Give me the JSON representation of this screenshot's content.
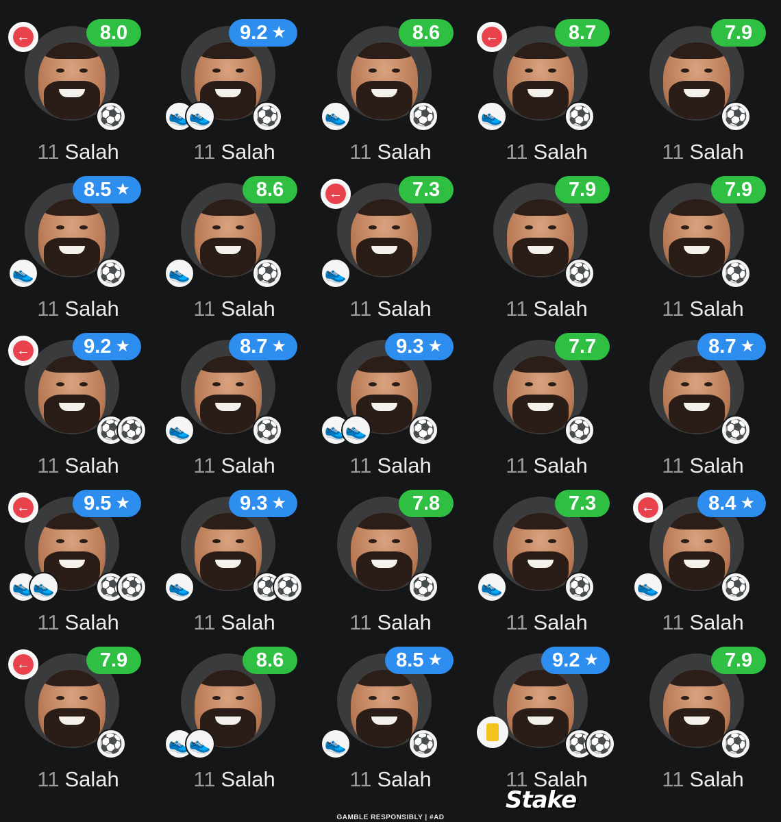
{
  "player_label": {
    "number": "11",
    "name": "Salah"
  },
  "icons": {
    "substitution": "substitution-arrow-icon",
    "goal": "football-icon",
    "assist": "boot-icon",
    "yellow_card": "yellow-card-icon",
    "motm": "star-icon"
  },
  "colors": {
    "rating_green": "#2fbf43",
    "rating_blue": "#2d8ef0",
    "sub_red": "#e8434c",
    "card_yellow": "#f2c31a"
  },
  "cards": [
    {
      "rating": "8.0",
      "star": false,
      "subbed": true,
      "yellow": false,
      "assists": 0,
      "goals": 1
    },
    {
      "rating": "9.2",
      "star": true,
      "subbed": false,
      "yellow": false,
      "assists": 2,
      "goals": 1
    },
    {
      "rating": "8.6",
      "star": false,
      "subbed": false,
      "yellow": false,
      "assists": 1,
      "goals": 1
    },
    {
      "rating": "8.7",
      "star": false,
      "subbed": true,
      "yellow": false,
      "assists": 1,
      "goals": 1
    },
    {
      "rating": "7.9",
      "star": false,
      "subbed": false,
      "yellow": false,
      "assists": 0,
      "goals": 1
    },
    {
      "rating": "8.5",
      "star": true,
      "subbed": false,
      "yellow": false,
      "assists": 1,
      "goals": 1
    },
    {
      "rating": "8.6",
      "star": false,
      "subbed": false,
      "yellow": false,
      "assists": 1,
      "goals": 1
    },
    {
      "rating": "7.3",
      "star": false,
      "subbed": true,
      "yellow": false,
      "assists": 1,
      "goals": 0
    },
    {
      "rating": "7.9",
      "star": false,
      "subbed": false,
      "yellow": false,
      "assists": 0,
      "goals": 1
    },
    {
      "rating": "7.9",
      "star": false,
      "subbed": false,
      "yellow": false,
      "assists": 0,
      "goals": 1
    },
    {
      "rating": "9.2",
      "star": true,
      "subbed": true,
      "yellow": false,
      "assists": 0,
      "goals": 2
    },
    {
      "rating": "8.7",
      "star": true,
      "subbed": false,
      "yellow": false,
      "assists": 1,
      "goals": 1
    },
    {
      "rating": "9.3",
      "star": true,
      "subbed": false,
      "yellow": false,
      "assists": 2,
      "goals": 1
    },
    {
      "rating": "7.7",
      "star": false,
      "subbed": false,
      "yellow": false,
      "assists": 0,
      "goals": 1
    },
    {
      "rating": "8.7",
      "star": true,
      "subbed": false,
      "yellow": false,
      "assists": 0,
      "goals": 1
    },
    {
      "rating": "9.5",
      "star": true,
      "subbed": true,
      "yellow": false,
      "assists": 2,
      "goals": 2
    },
    {
      "rating": "9.3",
      "star": true,
      "subbed": false,
      "yellow": false,
      "assists": 1,
      "goals": 2
    },
    {
      "rating": "7.8",
      "star": false,
      "subbed": false,
      "yellow": false,
      "assists": 0,
      "goals": 1
    },
    {
      "rating": "7.3",
      "star": false,
      "subbed": false,
      "yellow": false,
      "assists": 1,
      "goals": 1
    },
    {
      "rating": "8.4",
      "star": true,
      "subbed": true,
      "yellow": false,
      "assists": 1,
      "goals": 1
    },
    {
      "rating": "7.9",
      "star": false,
      "subbed": true,
      "yellow": false,
      "assists": 0,
      "goals": 1
    },
    {
      "rating": "8.6",
      "star": false,
      "subbed": false,
      "yellow": false,
      "assists": 2,
      "goals": 0
    },
    {
      "rating": "8.5",
      "star": true,
      "subbed": false,
      "yellow": false,
      "assists": 1,
      "goals": 1
    },
    {
      "rating": "9.2",
      "star": true,
      "subbed": false,
      "yellow": true,
      "assists": 0,
      "goals": 2
    },
    {
      "rating": "7.9",
      "star": false,
      "subbed": false,
      "yellow": false,
      "assists": 0,
      "goals": 1
    }
  ],
  "footer": {
    "brand": "Stake",
    "disclaimer": "GAMBLE RESPONSIBLY  |  #AD"
  }
}
